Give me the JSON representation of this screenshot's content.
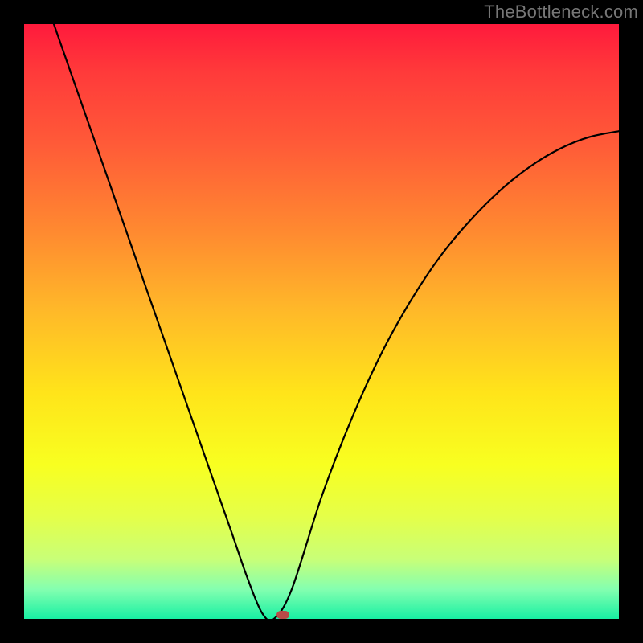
{
  "watermark": "TheBottleneck.com",
  "chart_data": {
    "type": "line",
    "title": "",
    "xlabel": "",
    "ylabel": "",
    "xlim": [
      0,
      1
    ],
    "ylim": [
      0,
      1
    ],
    "series": [
      {
        "name": "curve",
        "x": [
          0.05,
          0.1,
          0.15,
          0.2,
          0.25,
          0.3,
          0.35,
          0.375,
          0.4,
          0.42,
          0.45,
          0.5,
          0.55,
          0.6,
          0.65,
          0.7,
          0.75,
          0.8,
          0.85,
          0.9,
          0.95,
          1.0
        ],
        "y": [
          1.0,
          0.857,
          0.714,
          0.571,
          0.428,
          0.285,
          0.142,
          0.07,
          0.01,
          0.0,
          0.05,
          0.205,
          0.335,
          0.445,
          0.535,
          0.61,
          0.67,
          0.72,
          0.76,
          0.79,
          0.81,
          0.82
        ]
      }
    ],
    "marker": {
      "x": 0.435,
      "y": 0.007
    },
    "gradient_stops": [
      {
        "pos": 0.0,
        "color": "#ff1a3c"
      },
      {
        "pos": 0.2,
        "color": "#ff5a38"
      },
      {
        "pos": 0.48,
        "color": "#ffb829"
      },
      {
        "pos": 0.74,
        "color": "#f8ff20"
      },
      {
        "pos": 0.95,
        "color": "#84ffb0"
      },
      {
        "pos": 1.0,
        "color": "#18f0a3"
      }
    ]
  }
}
